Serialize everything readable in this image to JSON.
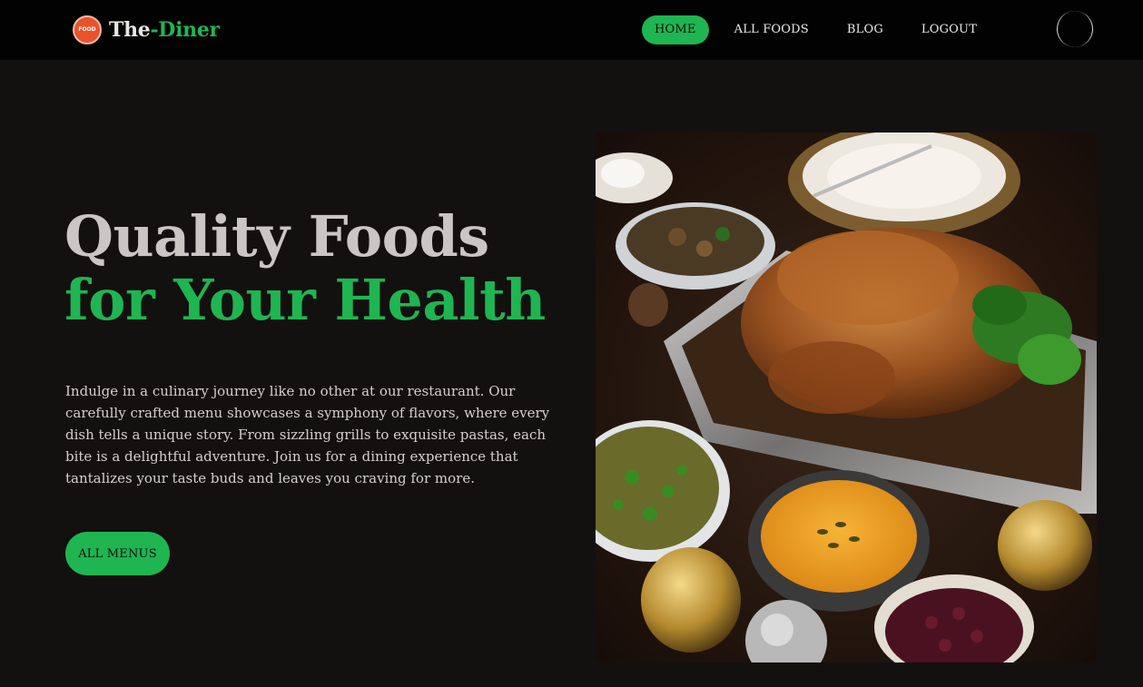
{
  "brand": {
    "badge_text": "FOOD",
    "name_part1": "The",
    "name_part2": "-Diner"
  },
  "nav": {
    "items": [
      {
        "label": "HOME",
        "active": true
      },
      {
        "label": "ALL FOODS",
        "active": false
      },
      {
        "label": "BLOG",
        "active": false
      },
      {
        "label": "LOGOUT",
        "active": false
      }
    ]
  },
  "hero": {
    "title_line1": "Quality Foods",
    "title_line2": "for Your Health",
    "description": "Indulge in a culinary journey like no other at our restaurant. Our carefully crafted menu showcases a symphony of flavors, where every dish tells a unique story. From sizzling grills to exquisite pastas, each bite is a delightful adventure. Join us for a dining experience that tantalizes your taste buds and leaves you craving for more.",
    "cta_label": "ALL MENUS"
  },
  "colors": {
    "accent": "#1fb551",
    "background": "#131010",
    "navbar": "#020202",
    "logo_badge": "#e8532c"
  },
  "icons": {
    "logo": "food-badge-icon",
    "user": "user-avatar-icon"
  }
}
